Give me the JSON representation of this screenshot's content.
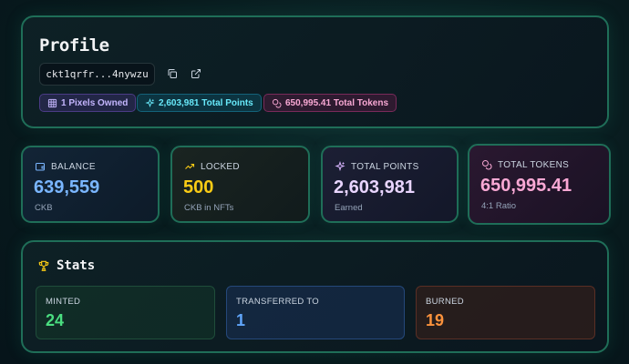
{
  "profile": {
    "title": "Profile",
    "address": "ckt1qrfr...4nywzu",
    "badges": {
      "pixels": "1 Pixels Owned",
      "points": "2,603,981 Total Points",
      "tokens": "650,995.41 Total Tokens"
    }
  },
  "cards": {
    "balance": {
      "label": "BALANCE",
      "value": "639,559",
      "sub": "CKB"
    },
    "locked": {
      "label": "LOCKED",
      "value": "500",
      "sub": "CKB in NFTs"
    },
    "points": {
      "label": "TOTAL POINTS",
      "value": "2,603,981",
      "sub": "Earned"
    },
    "tokens": {
      "label": "TOTAL TOKENS",
      "value": "650,995.41",
      "sub": "4:1 Ratio"
    }
  },
  "stats": {
    "title": "Stats",
    "minted": {
      "label": "MINTED",
      "value": "24"
    },
    "transferred": {
      "label": "TRANSFERRED TO",
      "value": "1"
    },
    "burned": {
      "label": "BURNED",
      "value": "19"
    }
  },
  "colors": {
    "border": "#1f6e58",
    "balance": "#7ab6ff",
    "locked": "#facc15",
    "points": "#e9d5ff",
    "tokens": "#f9a8d4",
    "minted": "#4ade80",
    "transferred": "#60a5fa",
    "burned": "#fb923c"
  },
  "icons": [
    "copy-icon",
    "external-link-icon",
    "grid-icon",
    "sparkle-icon",
    "coins-icon",
    "wallet-icon",
    "trending-up-icon",
    "trophy-icon"
  ]
}
